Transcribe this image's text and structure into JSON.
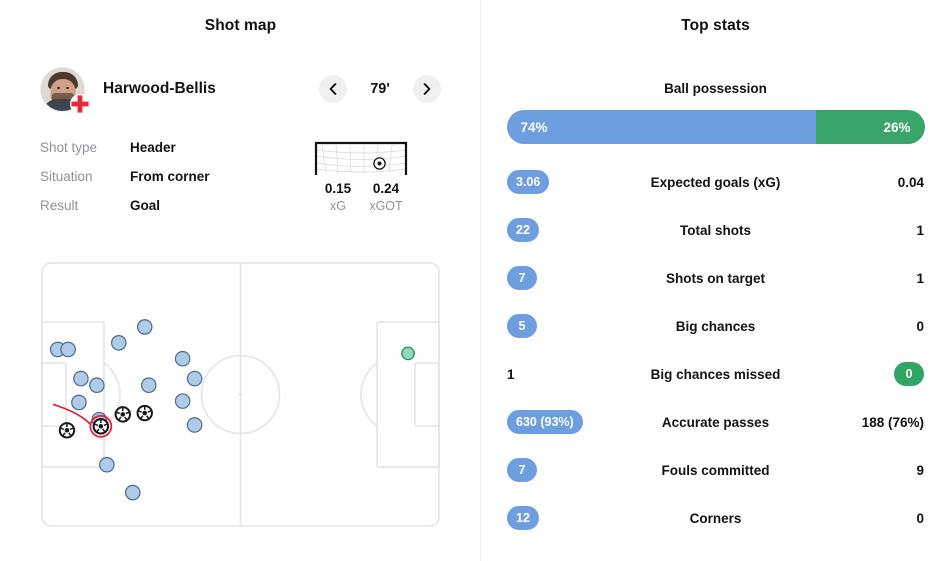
{
  "left": {
    "title": "Shot map",
    "player": {
      "name": "Harwood-Bellis",
      "avatar_name": "player-avatar",
      "flag": "england-flag"
    },
    "nav": {
      "prev_label": "‹",
      "next_label": "›",
      "minute": "79'"
    },
    "details": [
      {
        "label": "Shot type",
        "value": "Header"
      },
      {
        "label": "Situation",
        "value": "From corner"
      },
      {
        "label": "Result",
        "value": "Goal"
      }
    ],
    "goal_diagram": {
      "xg_value": "0.15",
      "xg_label": "xG",
      "xgot_value": "0.24",
      "xgot_label": "xGOT",
      "ball_x_pct": 70,
      "ball_y_pct": 62
    }
  },
  "right": {
    "title": "Top stats",
    "possession": {
      "label": "Ball possession",
      "home_value": "74%",
      "away_value": "26%",
      "home_pct": 74,
      "away_pct": 26
    },
    "stats": [
      {
        "label": "Expected goals (xG)",
        "home": "3.06",
        "away": "0.04",
        "home_style": "pill-blue",
        "away_style": "plain"
      },
      {
        "label": "Total shots",
        "home": "22",
        "away": "1",
        "home_style": "pill-blue",
        "away_style": "plain"
      },
      {
        "label": "Shots on target",
        "home": "7",
        "away": "1",
        "home_style": "pill-blue",
        "away_style": "plain"
      },
      {
        "label": "Big chances",
        "home": "5",
        "away": "0",
        "home_style": "pill-blue",
        "away_style": "plain"
      },
      {
        "label": "Big chances missed",
        "home": "1",
        "away": "0",
        "home_style": "plain",
        "away_style": "pill-green"
      },
      {
        "label": "Accurate passes",
        "home": "630 (93%)",
        "away": "188 (76%)",
        "home_style": "pill-blue",
        "away_style": "plain"
      },
      {
        "label": "Fouls committed",
        "home": "7",
        "away": "9",
        "home_style": "pill-blue",
        "away_style": "plain"
      },
      {
        "label": "Corners",
        "home": "12",
        "away": "0",
        "home_style": "pill-blue",
        "away_style": "plain"
      }
    ]
  },
  "colors": {
    "home_blue": "#6d9fe0",
    "away_green": "#3aa56b",
    "marker_blue_fill": "#aecbe9",
    "marker_blue_stroke": "#4a6b8a",
    "marker_green_fill": "#8fd9b6",
    "marker_green_stroke": "#2f8f63",
    "selected_red": "#e0243a",
    "pitch_line": "#e2e4e6"
  },
  "chart_data": {
    "type": "scatter",
    "title": "Shot map",
    "xlabel": "",
    "ylabel": "",
    "xlim": [
      0,
      100
    ],
    "ylim": [
      0,
      100
    ],
    "grid": false,
    "legend": [],
    "note": "Football pitch shot map. Coordinates are percentages of the pitch rectangle (x left->right, y top->bottom). Home team shoots toward the left goal; away team marker sits on the right half.",
    "series": [
      {
        "name": "Home shots (no goal)",
        "marker": "circle-blue",
        "points": [
          {
            "x": 4.2,
            "y": 33.0
          },
          {
            "x": 6.8,
            "y": 33.0
          },
          {
            "x": 10.0,
            "y": 44.0
          },
          {
            "x": 14.0,
            "y": 46.5
          },
          {
            "x": 9.5,
            "y": 53.0
          },
          {
            "x": 14.6,
            "y": 59.5
          },
          {
            "x": 19.5,
            "y": 30.5
          },
          {
            "x": 26.0,
            "y": 24.5
          },
          {
            "x": 27.0,
            "y": 46.5
          },
          {
            "x": 35.5,
            "y": 36.5
          },
          {
            "x": 38.5,
            "y": 44.0
          },
          {
            "x": 35.5,
            "y": 52.5
          },
          {
            "x": 38.5,
            "y": 61.5
          },
          {
            "x": 16.5,
            "y": 76.5
          },
          {
            "x": 23.0,
            "y": 87.0
          }
        ]
      },
      {
        "name": "Home shots (on target / goal)",
        "marker": "football-black",
        "points": [
          {
            "x": 6.5,
            "y": 63.5
          },
          {
            "x": 15.0,
            "y": 62.0
          },
          {
            "x": 20.5,
            "y": 57.5
          },
          {
            "x": 26.0,
            "y": 57.0
          }
        ]
      },
      {
        "name": "Selected shot (goal, 79')",
        "marker": "football-black-highlighted",
        "points": [
          {
            "x": 15.0,
            "y": 62.0
          }
        ]
      },
      {
        "name": "Away shots",
        "marker": "circle-green",
        "points": [
          {
            "x": 92.0,
            "y": 34.5
          }
        ]
      }
    ]
  }
}
